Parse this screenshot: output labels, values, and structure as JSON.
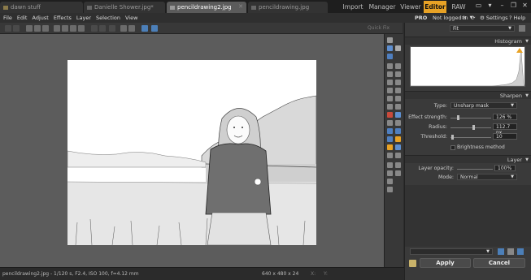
{
  "tabs": [
    {
      "label": "dawn stuff",
      "active": false
    },
    {
      "label": "Danielle Shower.jpg*",
      "active": false
    },
    {
      "label": "pencildrawing2.jpg",
      "active": true
    },
    {
      "label": "pencildrawing.jpg",
      "active": false
    }
  ],
  "modes": [
    {
      "label": "Import",
      "active": false
    },
    {
      "label": "Manager",
      "active": false
    },
    {
      "label": "Viewer",
      "active": false
    },
    {
      "label": "Editor",
      "active": true
    },
    {
      "label": "RAW",
      "active": false
    }
  ],
  "menu": [
    "File",
    "Edit",
    "Adjust",
    "Effects",
    "Layer",
    "Selection",
    "View"
  ],
  "account": {
    "pro": "PRO",
    "login": "Not logged in",
    "settings": "Settings",
    "help": "Help"
  },
  "toolbar": {
    "quick_fix": "Quick Fix",
    "zoom": "Fit"
  },
  "panel": {
    "histogram": "Histogram",
    "sharpen": {
      "header": "Sharpen",
      "type_label": "Type:",
      "type_value": "Unsharp mask",
      "strength_label": "Effect strength:",
      "strength_value": "126 %",
      "strength_fraction": 0.18,
      "radius_label": "Radius:",
      "radius_value": "112.7 px",
      "radius_fraction": 0.56,
      "threshold_label": "Threshold:",
      "threshold_value": "10",
      "threshold_fraction": 0.04,
      "brightness_label": "Brightness method"
    },
    "layer": {
      "header": "Layer",
      "opacity_label": "Layer opacity:",
      "opacity_value": "100%",
      "mode_label": "Mode:",
      "mode_value": "Normal"
    },
    "apply": "Apply",
    "cancel": "Cancel"
  },
  "status": {
    "file_info": "pencildrawing2.jpg - 1/120 s, F2.4, ISO 100, f=4.12 mm",
    "dimensions": "640 x 480 x 24",
    "coords_x": "X:",
    "coords_y": "Y:"
  },
  "colors": {
    "accent": "#e8a225",
    "active_tab": "#5b5b5b",
    "canvas": "#5c5c5c"
  }
}
